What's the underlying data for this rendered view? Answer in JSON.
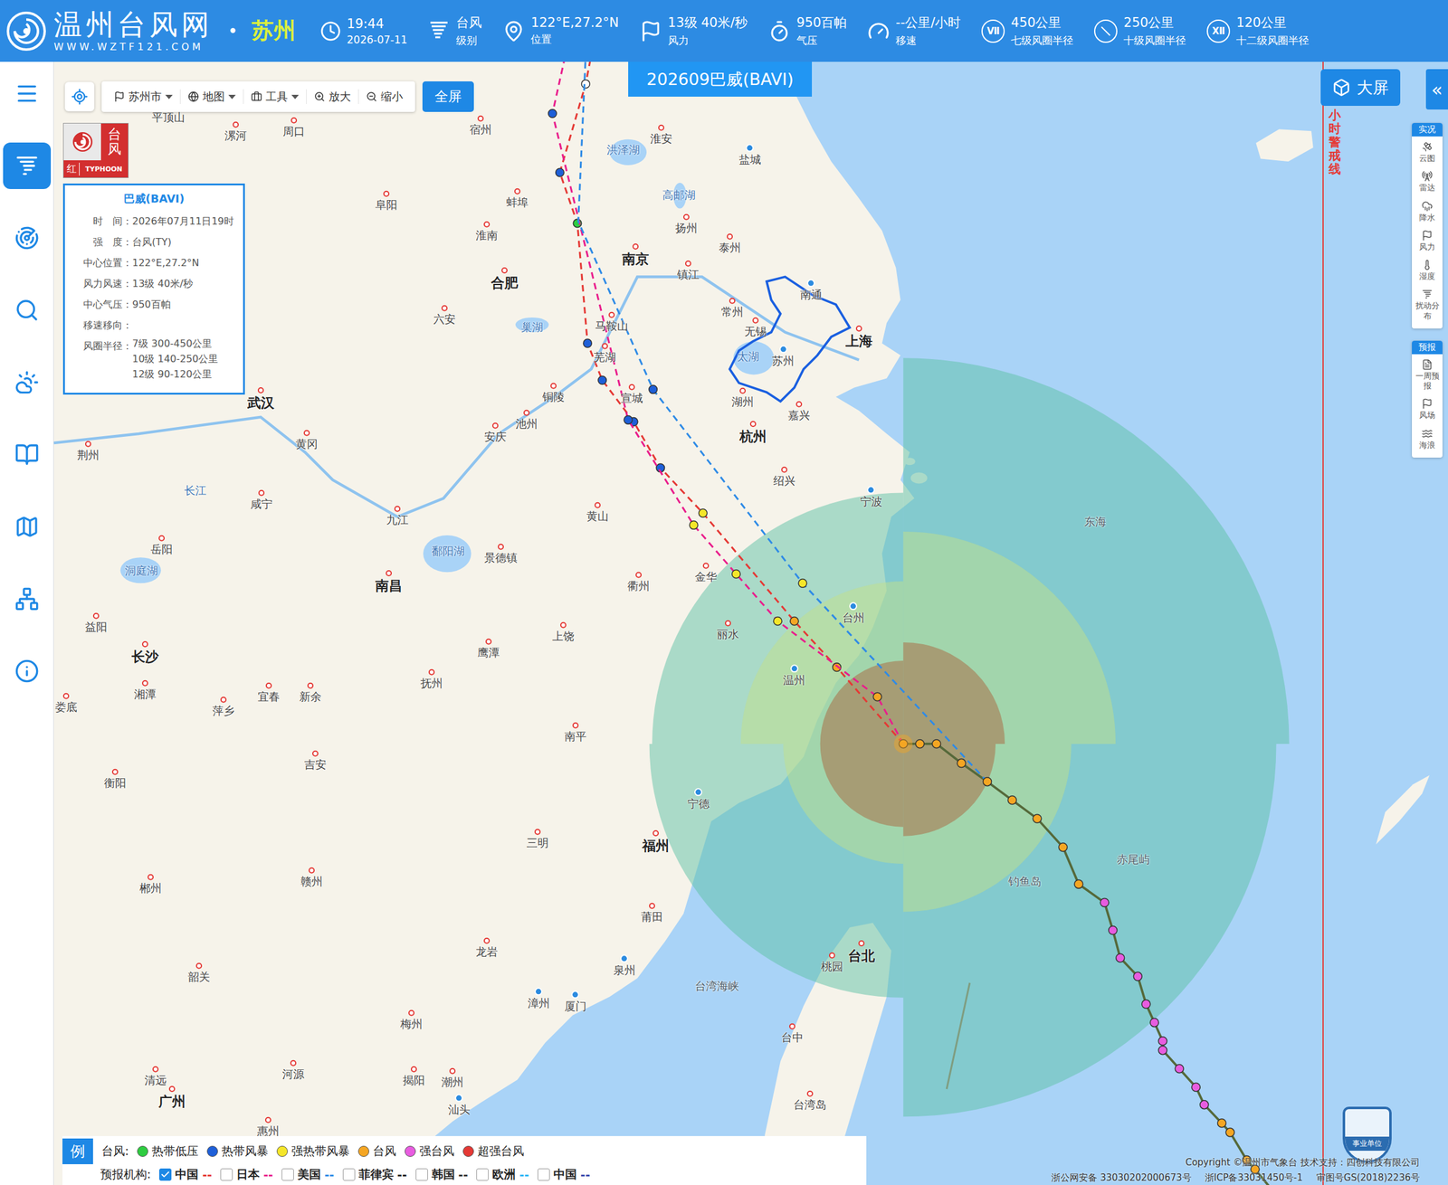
{
  "header": {
    "logo_title": "温州台风网",
    "logo_url": "WWW.WZTF121.COM",
    "separator": "•",
    "city": "苏州",
    "stats": [
      {
        "value": "19:44",
        "label": "2026-07-11",
        "badge": ""
      },
      {
        "value": "台风",
        "label": "级别",
        "badge": ""
      },
      {
        "value": "122°E,27.2°N",
        "label": "位置",
        "badge": ""
      },
      {
        "value": "13级 40米/秒",
        "label": "风力",
        "badge": ""
      },
      {
        "value": "950百帕",
        "label": "气压",
        "badge": ""
      },
      {
        "value": "--公里/小时",
        "label": "移速",
        "badge": ""
      },
      {
        "value": "450公里",
        "label": "七级风圈半径",
        "badge": "Ⅶ"
      },
      {
        "value": "250公里",
        "label": "十级风圈半径",
        "badge": ""
      },
      {
        "value": "120公里",
        "label": "十二级风圈半径",
        "badge": "Ⅻ"
      }
    ]
  },
  "sidebar": {
    "items": [
      {
        "selected": false
      },
      {
        "selected": true
      },
      {
        "selected": false
      },
      {
        "selected": false
      },
      {
        "selected": false
      },
      {
        "selected": false
      },
      {
        "selected": false
      },
      {
        "selected": false
      },
      {
        "selected": false
      }
    ]
  },
  "toolbar": {
    "items": [
      {
        "label": "苏州市",
        "dropdown": true
      },
      {
        "label": "地图",
        "dropdown": true
      },
      {
        "label": "工具",
        "dropdown": true
      },
      {
        "label": "放大",
        "dropdown": false
      },
      {
        "label": "缩小",
        "dropdown": false
      }
    ],
    "fullscreen": "全屏"
  },
  "title": "202609巴威(BAVI)",
  "warning_badge": {
    "title": "台风",
    "level": "红",
    "sub": "TYPHOON"
  },
  "info_panel": {
    "title": "巴威(BAVI)",
    "rows": [
      {
        "label": "时　间：",
        "lines": [
          "2026年07月11日19时"
        ]
      },
      {
        "label": "强　度：",
        "lines": [
          "台风(TY)"
        ]
      },
      {
        "label": "中心位置：",
        "lines": [
          "122°E,27.2°N"
        ]
      },
      {
        "label": "风力风速：",
        "lines": [
          "13级 40米/秒"
        ]
      },
      {
        "label": "中心气压：",
        "lines": [
          "950百帕"
        ]
      },
      {
        "label": "移速移向：",
        "lines": []
      },
      {
        "label": "风圈半径：",
        "lines": [
          "7级 300-450公里",
          "10级 140-250公里",
          "12级 90-120公里"
        ]
      }
    ]
  },
  "big_screen": "大屏",
  "collapse": "«",
  "warning_line": "小时警戒线",
  "side_panel": {
    "sections": [
      {
        "title": "实况",
        "items": [
          "云图",
          "雷达",
          "降水",
          "风力",
          "湿度",
          "扰动分布"
        ]
      },
      {
        "title": "预报",
        "items": [
          "一周预报",
          "风场",
          "海浪"
        ]
      }
    ]
  },
  "legend": {
    "badge": "例",
    "typhoon_label": "台风:",
    "levels": [
      {
        "name": "热带低压",
        "color": "#2ecc40"
      },
      {
        "name": "热带风暴",
        "color": "#1e5fd8"
      },
      {
        "name": "强热带风暴",
        "color": "#f5e62a"
      },
      {
        "name": "台风",
        "color": "#f5a623"
      },
      {
        "name": "强台风",
        "color": "#e85ce0"
      },
      {
        "name": "超强台风",
        "color": "#e53935"
      }
    ],
    "agency_label": "预报机构:",
    "agencies": [
      {
        "name": "中国",
        "checked": true,
        "mark": "--",
        "color": "#e53935",
        "forecast": [
          "台风",
          "台风",
          "强热带风暴",
          "热带风暴",
          "热带风暴",
          "热带风暴",
          "热带风暴",
          "热带低压",
          "热带风暴",
          ""
        ]
      },
      {
        "name": "日本",
        "checked": false,
        "mark": "--",
        "color": "#e91e8c",
        "forecast": [
          "台风",
          "强热带风暴",
          "强热带风暴",
          "强热带风暴",
          "热带风暴",
          "热带风暴"
        ]
      },
      {
        "name": "美国",
        "checked": false,
        "mark": "--",
        "color": "#2f8be6",
        "forecast": [
          "强热带风暴",
          "热带风暴"
        ]
      },
      {
        "name": "菲律宾",
        "checked": false,
        "mark": "--",
        "color": "#222222",
        "forecast": []
      },
      {
        "name": "韩国",
        "checked": false,
        "mark": "--",
        "color": "#333333",
        "forecast": []
      },
      {
        "name": "欧洲",
        "checked": false,
        "mark": "--",
        "color": "#29b6f6",
        "forecast": []
      },
      {
        "name": "中国",
        "checked": false,
        "mark": "--",
        "color": "#3949ab",
        "forecast": []
      }
    ]
  },
  "past_track": [
    "台风",
    "台风",
    "台风",
    "台风",
    "台风",
    "台风",
    "台风",
    "台风",
    "台风",
    "强台风",
    "强台风",
    "强台风",
    "强台风",
    "强台风",
    "强台风",
    "强台风",
    "强台风",
    "强台风",
    "强台风",
    "强台风",
    "台风",
    "台风",
    "台风",
    "台风"
  ],
  "wind_circles": [
    {
      "color": "#5ec2a5"
    },
    {
      "color": "#c2e08a"
    },
    {
      "color": "#a87850"
    }
  ],
  "footer": {
    "copyright": "Copyright ©温州市气象台 技术支持：四创科技有限公司",
    "records": [
      "浙公网安备 33030202000673号",
      "浙ICP备33031450号-1",
      "审图号GS(2018)2236号"
    ]
  },
  "seal": "事业单位",
  "cities": [
    {
      "name": "平顶山",
      "kind": "city"
    },
    {
      "name": "漯河",
      "kind": "city"
    },
    {
      "name": "周口",
      "kind": "city"
    },
    {
      "name": "宿州",
      "kind": "city"
    },
    {
      "name": "淮安",
      "kind": "city"
    },
    {
      "name": "盐城",
      "kind": "pin"
    },
    {
      "name": "洪泽湖",
      "kind": "water"
    },
    {
      "name": "阜阳",
      "kind": "city"
    },
    {
      "name": "蚌埠",
      "kind": "city"
    },
    {
      "name": "高邮湖",
      "kind": "water"
    },
    {
      "name": "扬州",
      "kind": "city"
    },
    {
      "name": "淮南",
      "kind": "city"
    },
    {
      "name": "泰州",
      "kind": "city"
    },
    {
      "name": "南京",
      "kind": "major"
    },
    {
      "name": "镇江",
      "kind": "city"
    },
    {
      "name": "合肥",
      "kind": "major"
    },
    {
      "name": "南通",
      "kind": "pin"
    },
    {
      "name": "常州",
      "kind": "city"
    },
    {
      "name": "六安",
      "kind": "city"
    },
    {
      "name": "巢湖",
      "kind": "water"
    },
    {
      "name": "马鞍山",
      "kind": "city"
    },
    {
      "name": "无锡",
      "kind": "city"
    },
    {
      "name": "上海",
      "kind": "major"
    },
    {
      "name": "太湖",
      "kind": "water"
    },
    {
      "name": "苏州",
      "kind": "pin"
    },
    {
      "name": "芜湖",
      "kind": "city"
    },
    {
      "name": "铜陵",
      "kind": "city"
    },
    {
      "name": "宣城",
      "kind": "city"
    },
    {
      "name": "湖州",
      "kind": "city"
    },
    {
      "name": "武汉",
      "kind": "major"
    },
    {
      "name": "嘉兴",
      "kind": "city"
    },
    {
      "name": "池州",
      "kind": "city"
    },
    {
      "name": "杭州",
      "kind": "major"
    },
    {
      "name": "安庆",
      "kind": "city"
    },
    {
      "name": "黄冈",
      "kind": "city"
    },
    {
      "name": "荆州",
      "kind": "city"
    },
    {
      "name": "绍兴",
      "kind": "city"
    },
    {
      "name": "宁波",
      "kind": "pin"
    },
    {
      "name": "长江",
      "kind": "water"
    },
    {
      "name": "咸宁",
      "kind": "city"
    },
    {
      "name": "九江",
      "kind": "city"
    },
    {
      "name": "黄山",
      "kind": "city"
    },
    {
      "name": "东海",
      "kind": "sea"
    },
    {
      "name": "岳阳",
      "kind": "city"
    },
    {
      "name": "鄱阳湖",
      "kind": "water"
    },
    {
      "name": "景德镇",
      "kind": "city"
    },
    {
      "name": "洞庭湖",
      "kind": "water"
    },
    {
      "name": "金华",
      "kind": "city"
    },
    {
      "name": "衢州",
      "kind": "city"
    },
    {
      "name": "南昌",
      "kind": "major"
    },
    {
      "name": "台州",
      "kind": "pin"
    },
    {
      "name": "益阳",
      "kind": "city"
    },
    {
      "name": "丽水",
      "kind": "city"
    },
    {
      "name": "上饶",
      "kind": "city"
    },
    {
      "name": "鹰潭",
      "kind": "city"
    },
    {
      "name": "长沙",
      "kind": "major"
    },
    {
      "name": "温州",
      "kind": "pin"
    },
    {
      "name": "抚州",
      "kind": "city"
    },
    {
      "name": "湘潭",
      "kind": "city"
    },
    {
      "name": "宜春",
      "kind": "city"
    },
    {
      "name": "新余",
      "kind": "city"
    },
    {
      "name": "娄底",
      "kind": "city"
    },
    {
      "name": "萍乡",
      "kind": "city"
    },
    {
      "name": "南平",
      "kind": "city"
    },
    {
      "name": "吉安",
      "kind": "city"
    },
    {
      "name": "衡阳",
      "kind": "city"
    },
    {
      "name": "宁德",
      "kind": "pin"
    },
    {
      "name": "三明",
      "kind": "city"
    },
    {
      "name": "福州",
      "kind": "major"
    },
    {
      "name": "赤尾屿",
      "kind": "sea"
    },
    {
      "name": "钓鱼岛",
      "kind": "sea"
    },
    {
      "name": "赣州",
      "kind": "city"
    },
    {
      "name": "郴州",
      "kind": "city"
    },
    {
      "name": "莆田",
      "kind": "city"
    },
    {
      "name": "龙岩",
      "kind": "city"
    },
    {
      "name": "台北",
      "kind": "major"
    },
    {
      "name": "桃园",
      "kind": "city"
    },
    {
      "name": "泉州",
      "kind": "pin"
    },
    {
      "name": "韶关",
      "kind": "city"
    },
    {
      "name": "台湾海峡",
      "kind": "sea"
    },
    {
      "name": "漳州",
      "kind": "pin"
    },
    {
      "name": "厦门",
      "kind": "pin"
    },
    {
      "name": "梅州",
      "kind": "city"
    },
    {
      "name": "台中",
      "kind": "city"
    },
    {
      "name": "河源",
      "kind": "city"
    },
    {
      "name": "清远",
      "kind": "city"
    },
    {
      "name": "揭阳",
      "kind": "city"
    },
    {
      "name": "潮州",
      "kind": "city"
    },
    {
      "name": "广州",
      "kind": "major"
    },
    {
      "name": "台湾岛",
      "kind": "city"
    },
    {
      "name": "汕头",
      "kind": "pin"
    },
    {
      "name": "惠州",
      "kind": "city"
    }
  ]
}
